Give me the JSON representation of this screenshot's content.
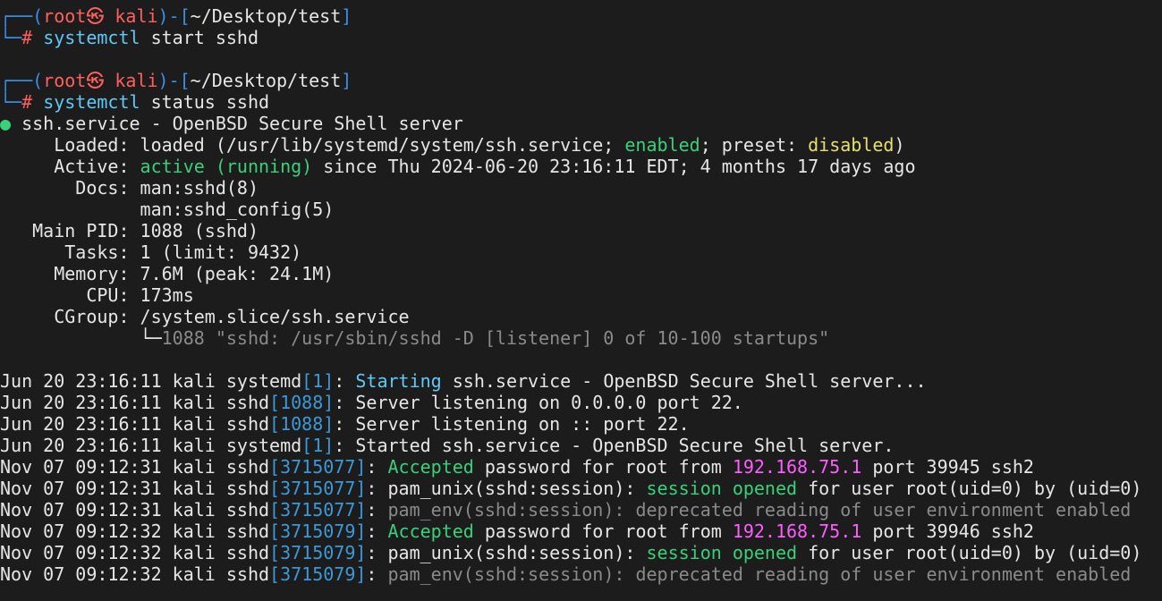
{
  "colors": {
    "bracket": "#3a8ee6",
    "user": "#ff5f5f",
    "command": "#5fc9f8",
    "ok": "#3ad07a",
    "warn": "#e6e06a",
    "ip": "#ff5cff",
    "muted": "#8a8a8a",
    "background": "#1c1c1c",
    "text": "#e6e6e6"
  },
  "lines": [
    {
      "segments": [
        [
          "┌──(",
          "blue"
        ],
        [
          "root㉿ kali",
          "red"
        ],
        [
          ")-[",
          "blue"
        ],
        [
          "~/Desktop/test",
          "white"
        ],
        [
          "]",
          "blue"
        ]
      ]
    },
    {
      "segments": [
        [
          "└─",
          "blue"
        ],
        [
          "# ",
          "red"
        ],
        [
          "systemctl",
          "cyan"
        ],
        [
          " start sshd",
          "white"
        ]
      ]
    },
    {
      "segments": []
    },
    {
      "segments": [
        [
          "┌──(",
          "blue"
        ],
        [
          "root㉿ kali",
          "red"
        ],
        [
          ")-[",
          "blue"
        ],
        [
          "~/Desktop/test",
          "white"
        ],
        [
          "]",
          "blue"
        ]
      ]
    },
    {
      "segments": [
        [
          "└─",
          "blue"
        ],
        [
          "# ",
          "red"
        ],
        [
          "systemctl",
          "cyan"
        ],
        [
          " status sshd",
          "white"
        ]
      ]
    },
    {
      "segments": [
        [
          "●",
          "dot"
        ],
        [
          " ssh.service - OpenBSD Secure Shell server",
          "white"
        ]
      ]
    },
    {
      "segments": [
        [
          "     Loaded: loaded (/usr/lib/systemd/system/ssh.service; ",
          "white"
        ],
        [
          "enabled",
          "green"
        ],
        [
          "; preset: ",
          "white"
        ],
        [
          "disabled",
          "yellow"
        ],
        [
          ")",
          "white"
        ]
      ]
    },
    {
      "segments": [
        [
          "     Active: ",
          "white"
        ],
        [
          "active (running)",
          "green"
        ],
        [
          " since Thu 2024-06-20 23:16:11 EDT; 4 months 17 days ago",
          "white"
        ]
      ]
    },
    {
      "segments": [
        [
          "       Docs: man:sshd(8)",
          "white"
        ]
      ]
    },
    {
      "segments": [
        [
          "             man:sshd_config(5)",
          "white"
        ]
      ]
    },
    {
      "segments": [
        [
          "   Main PID: 1088 (sshd)",
          "white"
        ]
      ]
    },
    {
      "segments": [
        [
          "      Tasks: 1 (limit: 9432)",
          "white"
        ]
      ]
    },
    {
      "segments": [
        [
          "     Memory: 7.6M (peak: 24.1M)",
          "white"
        ]
      ]
    },
    {
      "segments": [
        [
          "        CPU: 173ms",
          "white"
        ]
      ]
    },
    {
      "segments": [
        [
          "     CGroup: /system.slice/ssh.service",
          "white"
        ]
      ]
    },
    {
      "segments": [
        [
          "             └─",
          "white"
        ],
        [
          "1088 \"sshd: /usr/sbin/sshd -D [listener] 0 of 10-100 startups\"",
          "gray"
        ]
      ]
    },
    {
      "segments": []
    },
    {
      "segments": [
        [
          "Jun 20 23:16:11 kali systemd",
          "white"
        ],
        [
          "[1]",
          "idx"
        ],
        [
          ": ",
          "white"
        ],
        [
          "Starting",
          "cyan"
        ],
        [
          " ssh.service - OpenBSD Secure Shell server...",
          "white"
        ]
      ]
    },
    {
      "segments": [
        [
          "Jun 20 23:16:11 kali sshd",
          "white"
        ],
        [
          "[1088]",
          "idx"
        ],
        [
          ": Server listening on 0.0.0.0 port 22.",
          "white"
        ]
      ]
    },
    {
      "segments": [
        [
          "Jun 20 23:16:11 kali sshd",
          "white"
        ],
        [
          "[1088]",
          "idx"
        ],
        [
          ": Server listening on :: port 22.",
          "white"
        ]
      ]
    },
    {
      "segments": [
        [
          "Jun 20 23:16:11 kali systemd",
          "white"
        ],
        [
          "[1]",
          "idx"
        ],
        [
          ": Started ssh.service - OpenBSD Secure Shell server.",
          "white"
        ]
      ]
    },
    {
      "segments": [
        [
          "Nov 07 09:12:31 kali sshd",
          "white"
        ],
        [
          "[3715077]",
          "idx"
        ],
        [
          ": ",
          "white"
        ],
        [
          "Accepted",
          "green"
        ],
        [
          " password for root from ",
          "white"
        ],
        [
          "192.168.75.1",
          "mag"
        ],
        [
          " port 39945 ssh2",
          "white"
        ]
      ]
    },
    {
      "segments": [
        [
          "Nov 07 09:12:31 kali sshd",
          "white"
        ],
        [
          "[3715077]",
          "idx"
        ],
        [
          ": pam_unix(sshd:session): ",
          "white"
        ],
        [
          "session opened",
          "green"
        ],
        [
          " for user root(uid=0) by (uid=0)",
          "white"
        ]
      ]
    },
    {
      "segments": [
        [
          "Nov 07 09:12:31 kali sshd",
          "white"
        ],
        [
          "[3715077]",
          "idx"
        ],
        [
          ": ",
          "white"
        ],
        [
          "pam_env(sshd:session): deprecated reading of user environment enabled",
          "gray"
        ]
      ]
    },
    {
      "segments": [
        [
          "Nov 07 09:12:32 kali sshd",
          "white"
        ],
        [
          "[3715079]",
          "idx"
        ],
        [
          ": ",
          "white"
        ],
        [
          "Accepted",
          "green"
        ],
        [
          " password for root from ",
          "white"
        ],
        [
          "192.168.75.1",
          "mag"
        ],
        [
          " port 39946 ssh2",
          "white"
        ]
      ]
    },
    {
      "segments": [
        [
          "Nov 07 09:12:32 kali sshd",
          "white"
        ],
        [
          "[3715079]",
          "idx"
        ],
        [
          ": pam_unix(sshd:session): ",
          "white"
        ],
        [
          "session opened",
          "green"
        ],
        [
          " for user root(uid=0) by (uid=0)",
          "white"
        ]
      ]
    },
    {
      "segments": [
        [
          "Nov 07 09:12:32 kali sshd",
          "white"
        ],
        [
          "[3715079]",
          "idx"
        ],
        [
          ": ",
          "white"
        ],
        [
          "pam_env(sshd:session): deprecated reading of user environment enabled",
          "gray"
        ]
      ]
    }
  ]
}
